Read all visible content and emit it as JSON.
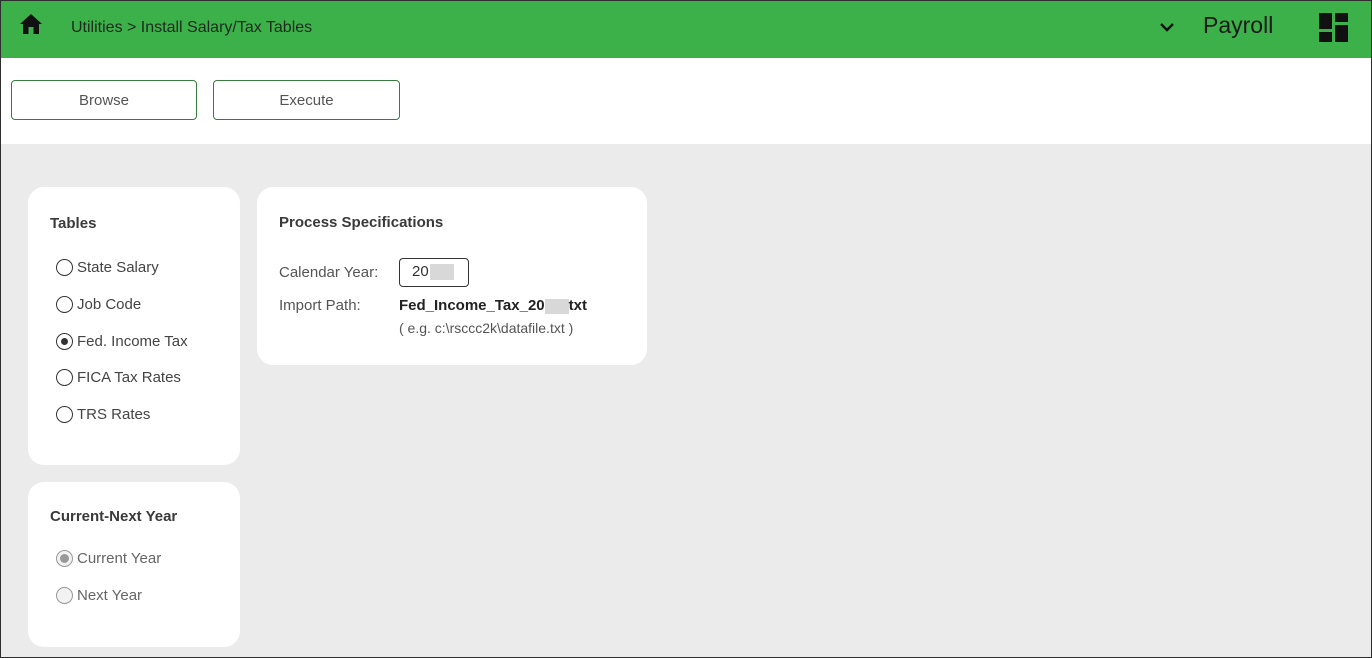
{
  "header": {
    "breadcrumb": "Utilities > Install Salary/Tax Tables",
    "app_name": "Payroll",
    "background_color": "#3cb14a",
    "icons": [
      "home-icon",
      "chevron-down-icon",
      "dashboard-grid-icon"
    ]
  },
  "toolbar": {
    "browse_label": "Browse",
    "execute_label": "Execute"
  },
  "tables": {
    "title": "Tables",
    "options": [
      {
        "label": "State Salary",
        "selected": false
      },
      {
        "label": "Job Code",
        "selected": false
      },
      {
        "label": "Fed. Income Tax",
        "selected": true
      },
      {
        "label": "FICA Tax Rates",
        "selected": false
      },
      {
        "label": "TRS Rates",
        "selected": false
      }
    ]
  },
  "current_next_year": {
    "title": "Current-Next Year",
    "options": [
      {
        "label": "Current Year",
        "selected": true,
        "disabled": true
      },
      {
        "label": "Next Year",
        "selected": false,
        "disabled": true
      }
    ]
  },
  "process_specifications": {
    "title": "Process Specifications",
    "calendar_year_label": "Calendar Year:",
    "calendar_year_value": "20",
    "import_path_label": "Import Path:",
    "import_path_prefix": "Fed_Income_Tax_20",
    "import_path_suffix": "txt",
    "import_path_hint": "( e.g. c:\\rsccc2k\\datafile.txt )"
  }
}
